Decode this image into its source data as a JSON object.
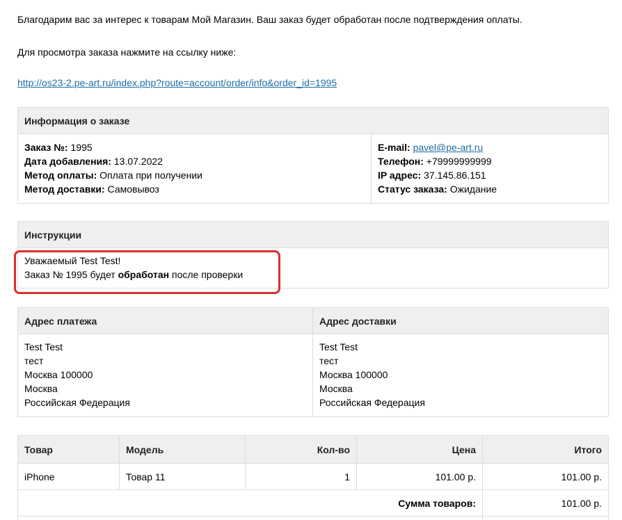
{
  "intro": {
    "thanks": "Благодарим вас за интерес к товарам Мой Магазин. Ваш заказ будет обработан после подтверждения оплаты.",
    "view_prompt": "Для просмотра заказа нажмите на ссылку ниже:",
    "order_link": "http://os23-2.pe-art.ru/index.php?route=account/order/info&order_id=1995"
  },
  "order_info": {
    "header": "Информация о заказе",
    "left": [
      {
        "label": "Заказ №:",
        "value": "1995"
      },
      {
        "label": "Дата добавления:",
        "value": "13.07.2022"
      },
      {
        "label": "Метод оплаты:",
        "value": "Оплата при получении"
      },
      {
        "label": "Метод доставки:",
        "value": "Самовывоз"
      }
    ],
    "right": [
      {
        "label": "E-mail:",
        "value": "pavel@pe-art.ru"
      },
      {
        "label": "Телефон:",
        "value": "+79999999999"
      },
      {
        "label": "IP адрес:",
        "value": "37.145.86.151"
      },
      {
        "label": "Статус заказа:",
        "value": "Ожидание"
      }
    ]
  },
  "instructions": {
    "header": "Инструкции",
    "greeting": "Уважаемый Test Test!",
    "line_before": "Заказ № 1995 будет",
    "line_bold": "обработан",
    "line_after": "после проверки"
  },
  "addresses": {
    "payment_header": "Адрес платежа",
    "shipping_header": "Адрес доставки",
    "payment_lines": [
      "Test Test",
      "тест",
      "Москва 100000",
      "Москва",
      "Российская Федерация"
    ],
    "shipping_lines": [
      "Test Test",
      "тест",
      "Москва 100000",
      "Москва",
      "Российская Федерация"
    ]
  },
  "products": {
    "headers": {
      "product": "Товар",
      "model": "Модель",
      "qty": "Кол-во",
      "price": "Цена",
      "total": "Итого"
    },
    "rows": [
      {
        "product": "iPhone",
        "model": "Товар 11",
        "qty": "1",
        "price": "101.00 р.",
        "total": "101.00 р."
      }
    ],
    "subtotal_label": "Сумма товаров:",
    "subtotal_value": "101.00 р."
  },
  "colors": {
    "link": "#1c6ea4",
    "header_bg": "#efefef",
    "border": "#dddddd",
    "highlight": "#d9302c"
  }
}
